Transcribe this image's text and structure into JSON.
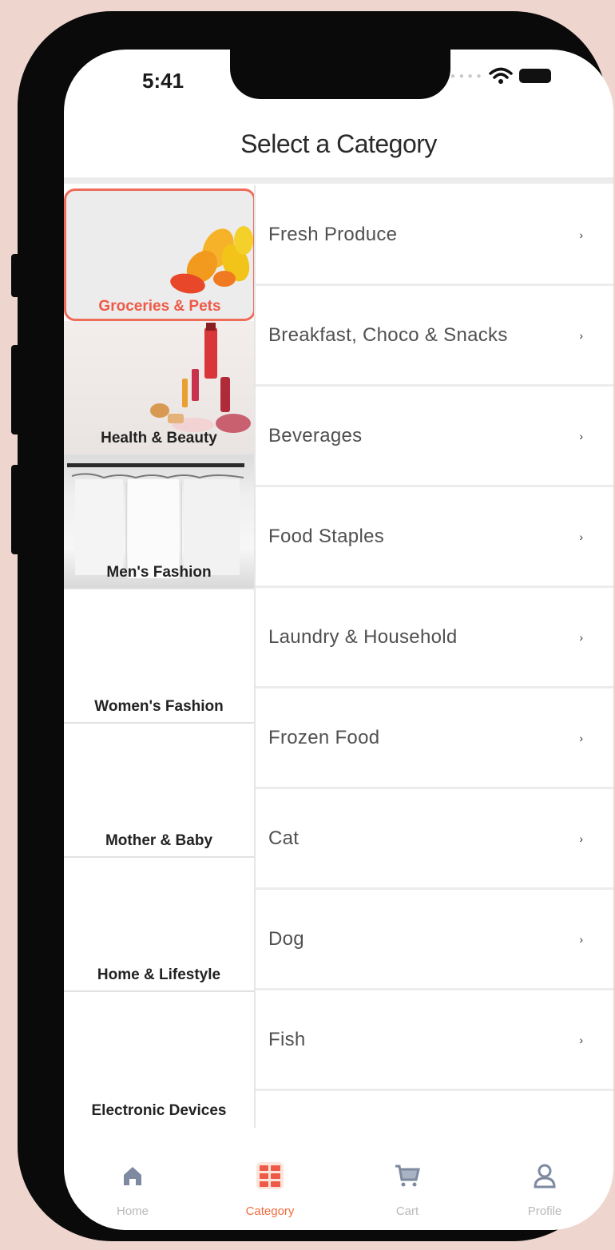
{
  "status_bar": {
    "time": "5:41"
  },
  "header": {
    "title": "Select a Category"
  },
  "categories": [
    {
      "label": "Groceries & Pets",
      "active": true
    },
    {
      "label": "Health & Beauty",
      "active": false
    },
    {
      "label": "Men's Fashion",
      "active": false
    },
    {
      "label": "Women's Fashion",
      "active": false
    },
    {
      "label": "Mother & Baby",
      "active": false
    },
    {
      "label": "Home & Lifestyle",
      "active": false
    },
    {
      "label": "Electronic Devices",
      "active": false
    }
  ],
  "subcategories": [
    {
      "label": "Fresh Produce",
      "icon": "chevron-right-icon"
    },
    {
      "label": "Breakfast, Choco & Snacks",
      "icon": "chevron-right-icon"
    },
    {
      "label": "Beverages",
      "icon": "chevron-right-icon"
    },
    {
      "label": "Food Staples",
      "icon": "chevron-right-icon"
    },
    {
      "label": "Laundry & Household",
      "icon": "chevron-right-icon"
    },
    {
      "label": "Frozen Food",
      "icon": "chevron-right-icon"
    },
    {
      "label": "Cat",
      "icon": "chevron-right-icon"
    },
    {
      "label": "Dog",
      "icon": "chevron-right-icon"
    },
    {
      "label": "Fish",
      "icon": "chevron-right-icon"
    }
  ],
  "tabbar": {
    "items": [
      {
        "label": "Home",
        "icon": "home-icon",
        "active": false
      },
      {
        "label": "Category",
        "icon": "category-icon",
        "active": true
      },
      {
        "label": "Cart",
        "icon": "cart-icon",
        "active": false
      },
      {
        "label": "Profile",
        "icon": "profile-icon",
        "active": false
      }
    ]
  },
  "colors": {
    "accent": "#ee5a48",
    "tab_active": "#ef6c3d",
    "tab_inactive": "#b9b9b9",
    "background": "#eed6cf"
  },
  "chevron_glyph": "›"
}
